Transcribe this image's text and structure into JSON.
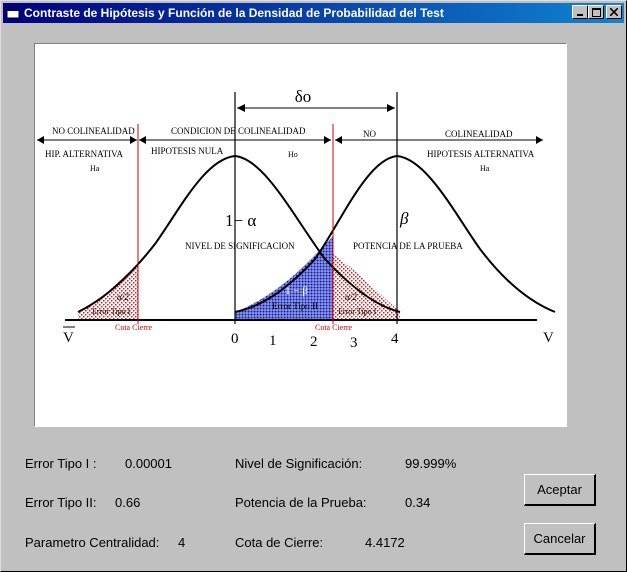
{
  "window": {
    "title": "Contraste de Hipótesis y Función de la Densidad de Probabilidad del Test"
  },
  "diagram": {
    "delta": "δo",
    "no_colinealidad_left": "NO COLINEALIDAD",
    "condicion": "CONDICION DE COLINEALIDAD",
    "no": "NO",
    "colinealidad_right": "COLINEALIDAD",
    "hip_alt_left": "HIP.   ALTERNATIVA",
    "ha_left": "Ha",
    "hipotesis_nula": "HIPOTESIS NULA",
    "ho": "Ho",
    "hip_alt_right": "HIPOTESIS ALTERNATIVA",
    "ha_right": "Ha",
    "one_minus_alpha": "1− α",
    "beta": "β",
    "nivel_sig": "NIVEL DE SIGNIFICACION",
    "potencia": "POTENCIA DE LA PRUEBA",
    "alpha_half_left": "α/2",
    "error1_left": "Error Tipo I",
    "one_minus_beta": "1 − β",
    "error2": "Error Tipo II",
    "alpha_half_right": "α/2",
    "error1_right": "Error Tipo I",
    "cota_left": "Cota  Cierre",
    "cota_right": "Cota  Cierre",
    "vbar": "V",
    "v": "V",
    "ticks": [
      "0",
      "1",
      "2",
      "3",
      "4"
    ]
  },
  "results": {
    "error1_label": "Error Tipo I :",
    "error1_value": "0.00001",
    "error2_label": "Error Tipo II:",
    "error2_value": "0.66",
    "centralidad_label": "Parametro Centralidad:",
    "centralidad_value": "4",
    "nivel_label": "Nivel de Significación:",
    "nivel_value": "99.999%",
    "potencia_label": "Potencia de la Prueba:",
    "potencia_value": "0.34",
    "cota_label": "Cota de Cierre:",
    "cota_value": "4.4172"
  },
  "buttons": {
    "accept": "Aceptar",
    "cancel": "Cancelar"
  }
}
